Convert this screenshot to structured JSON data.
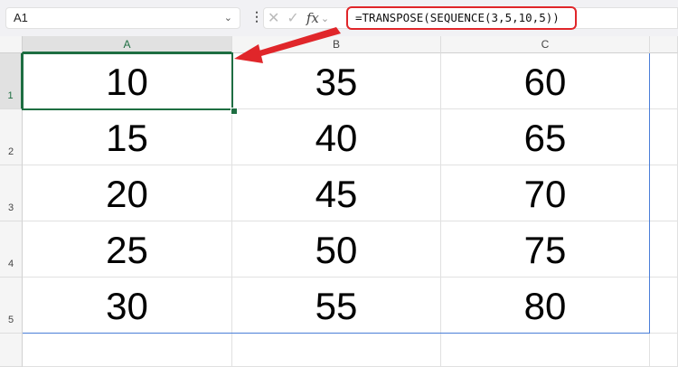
{
  "name_box": "A1",
  "formula_bar": {
    "fx_label": "fx",
    "formula": "=TRANSPOSE(SEQUENCE(3,5,10,5))"
  },
  "columns": [
    "A",
    "B",
    "C"
  ],
  "rows": [
    "1",
    "2",
    "3",
    "4",
    "5"
  ],
  "cells": [
    [
      "10",
      "35",
      "60"
    ],
    [
      "15",
      "40",
      "65"
    ],
    [
      "20",
      "45",
      "70"
    ],
    [
      "25",
      "50",
      "75"
    ],
    [
      "30",
      "55",
      "80"
    ]
  ],
  "colors": {
    "selection": "#1e6e42",
    "annotation": "#e0262a",
    "spill_border": "#4a7ed8"
  }
}
